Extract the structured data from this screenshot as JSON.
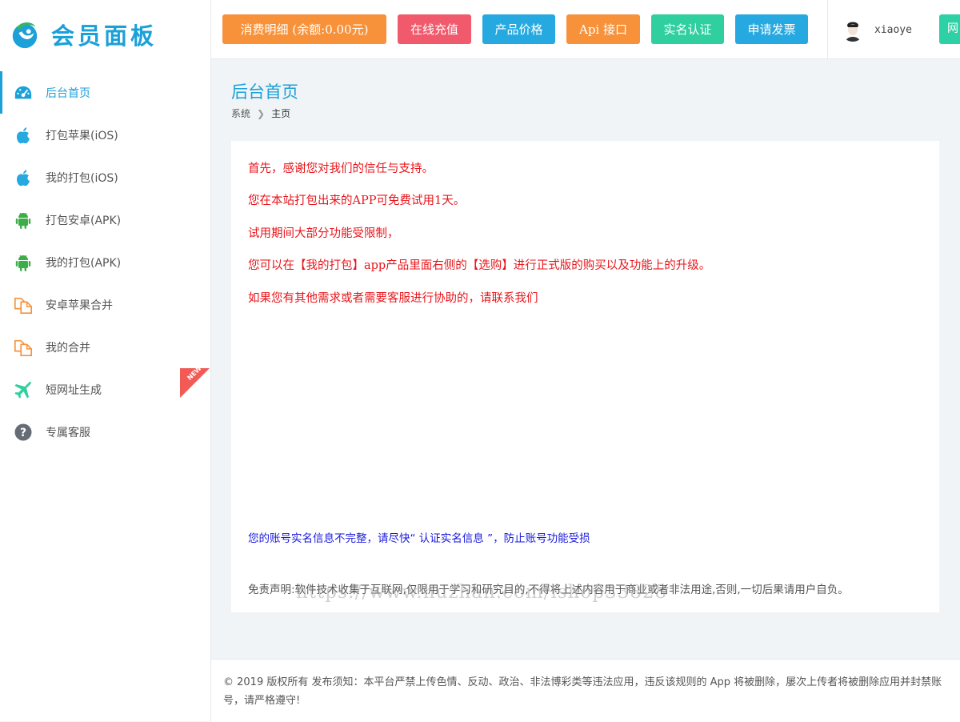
{
  "app": {
    "logo_text": "会员面板"
  },
  "topbar": {
    "buttons": [
      {
        "label": "消费明细 (余额:0.00元)",
        "color": "#f7923a"
      },
      {
        "label": "在线充值",
        "color": "#f15a6c"
      },
      {
        "label": "产品价格",
        "color": "#26a9e0"
      },
      {
        "label": "Api 接口",
        "color": "#f7923a"
      },
      {
        "label": "实名认证",
        "color": "#2fcf9f"
      },
      {
        "label": "申请发票",
        "color": "#26a9e0"
      }
    ],
    "username": "xiaoye",
    "edge_button_label": "网"
  },
  "sidebar": {
    "items": [
      {
        "label": "后台首页",
        "icon": "dashboard-icon",
        "active": true
      },
      {
        "label": "打包苹果(iOS)",
        "icon": "apple-icon"
      },
      {
        "label": "我的打包(iOS)",
        "icon": "apple-icon"
      },
      {
        "label": "打包安卓(APK)",
        "icon": "android-icon"
      },
      {
        "label": "我的打包(APK)",
        "icon": "android-icon"
      },
      {
        "label": "安卓苹果合并",
        "icon": "copy-icon"
      },
      {
        "label": "我的合并",
        "icon": "copy-icon"
      },
      {
        "label": "短网址生成",
        "icon": "plane-icon",
        "badge": "NEW"
      },
      {
        "label": "专属客服",
        "icon": "question-icon"
      }
    ]
  },
  "main": {
    "title": "后台首页",
    "breadcrumb": [
      "系统",
      "主页"
    ],
    "notices": [
      "首先，感谢您对我们的信任与支持。",
      "您在本站打包出来的APP可免费试用1天。",
      "试用期间大部分功能受限制，",
      "您可以在【我的打包】app产品里面右侧的【选购】进行正式版的购买以及功能上的升级。",
      "如果您有其他需求或者需要客服进行协助的，请联系我们"
    ],
    "verify_notice": "您的账号实名信息不完整，请尽快“ 认证实名信息 ”，防止账号功能受损",
    "disclaimer": "免责声明:软件技术收集于互联网,仅限用于学习和研究目的,不得将上述内容用于商业或者非法用途,否则,一切后果请用户自负。",
    "watermark": "https://www.huzhan.com/ishop33828"
  },
  "footer": {
    "text": "© 2019 版权所有 发布须知：本平台严禁上传色情、反动、政治、非法博彩类等违法应用，违反该规则的 App 将被删除，屡次上传者将被删除应用并封禁账号，请严格遵守!"
  }
}
